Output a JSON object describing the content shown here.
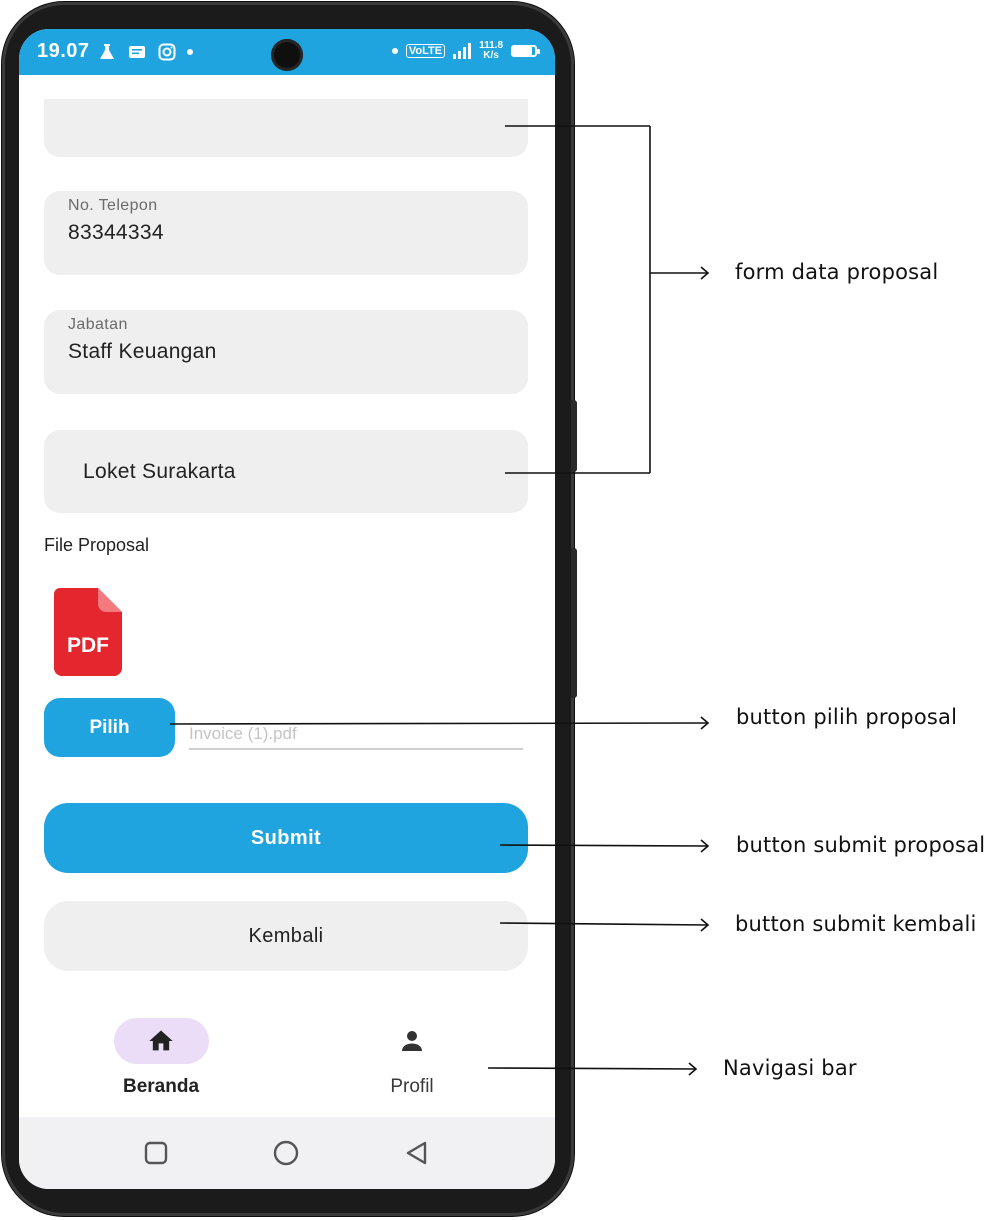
{
  "status_bar": {
    "time": "19.07",
    "network_label": "VoLTE",
    "speed_value": "111.8",
    "speed_unit": "K/s"
  },
  "form": {
    "fields": [
      {
        "label": "",
        "value": ""
      },
      {
        "label": "No. Telepon",
        "value": "83344334"
      },
      {
        "label": "Jabatan",
        "value": "Staff Keuangan"
      },
      {
        "label": "",
        "value": "Loket Surakarta"
      }
    ],
    "file_section_label": "File Proposal",
    "pdf_icon_text": "PDF",
    "pick_button_label": "Pilih",
    "file_placeholder": "Invoice (1).pdf",
    "submit_label": "Submit",
    "back_label": "Kembali"
  },
  "bottom_nav": {
    "items": [
      {
        "label": "Beranda",
        "icon": "home-icon",
        "active": true
      },
      {
        "label": "Profil",
        "icon": "person-icon",
        "active": false
      }
    ]
  },
  "annotations": {
    "form": "form data proposal",
    "pick": "button pilih proposal",
    "submit": "button submit proposal",
    "back": "button submit kembali",
    "nav": "Navigasi bar"
  },
  "colors": {
    "accent": "#20a4df",
    "field_bg": "#efeff0",
    "nav_active_pill": "#ebddf7",
    "pdf_red": "#e4262e"
  }
}
